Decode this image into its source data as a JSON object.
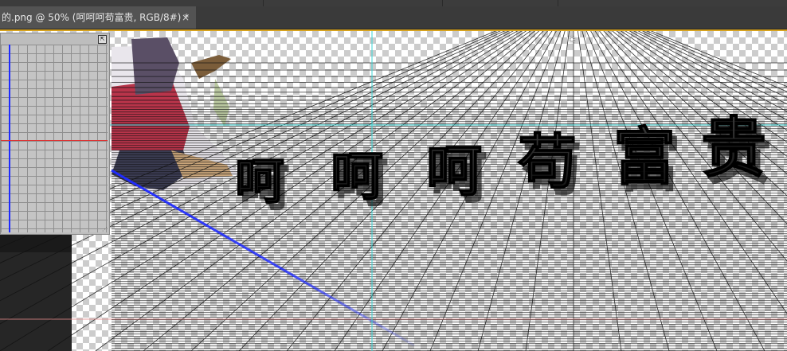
{
  "document_tab": {
    "title": "的.png @ 50% (呵呵呵苟富贵, RGB/8#) *",
    "close_label": "×"
  },
  "canvas": {
    "headline_text": "呵呵呵苟富贵"
  },
  "colors": {
    "accent_orange": "#d6a21e",
    "guide_cyan": "#38d6d6",
    "grid_blue": "#1f2bff",
    "grid_red": "#dd3333"
  },
  "icons": {
    "sun": "light-source-icon",
    "panel_toggle": "panel-expand-icon",
    "panel_grip": "resize-grip-icon"
  },
  "icon_glyphs": {
    "sun": "☀",
    "panel_toggle": "⇱",
    "panel_grip": "⋰"
  }
}
